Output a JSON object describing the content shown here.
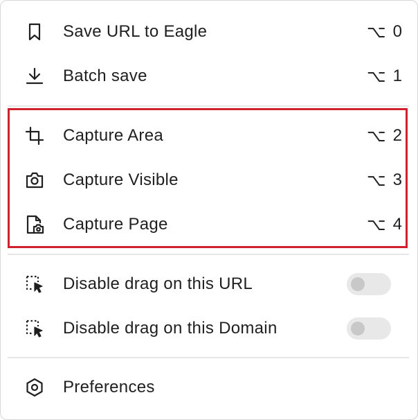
{
  "menu": {
    "save_url": {
      "label": "Save URL to Eagle",
      "key": "0",
      "modifier": "⌥",
      "icon": "bookmark-icon"
    },
    "batch_save": {
      "label": "Batch save",
      "key": "1",
      "modifier": "⌥",
      "icon": "download-icon"
    },
    "capture_area": {
      "label": "Capture Area",
      "key": "2",
      "modifier": "⌥",
      "icon": "crop-icon"
    },
    "capture_visible": {
      "label": "Capture Visible",
      "key": "3",
      "modifier": "⌥",
      "icon": "camera-icon"
    },
    "capture_page": {
      "label": "Capture Page",
      "key": "4",
      "modifier": "⌥",
      "icon": "page-camera-icon"
    },
    "disable_drag_url": {
      "label": "Disable drag on this URL",
      "enabled": false,
      "icon": "drag-select-icon"
    },
    "disable_drag_domain": {
      "label": "Disable drag on this Domain",
      "enabled": false,
      "icon": "drag-select-icon"
    },
    "preferences": {
      "label": "Preferences",
      "icon": "hexagon-settings-icon"
    }
  },
  "colors": {
    "highlight_border": "#d0202e",
    "divider": "#e6e6e6",
    "toggle_off": "#e8e8e8"
  }
}
